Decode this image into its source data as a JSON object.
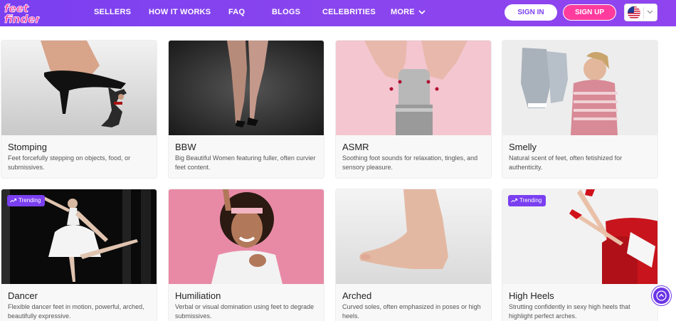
{
  "header": {
    "brand_color": "#7a3ff0",
    "nav": [
      {
        "label": "SELLERS"
      },
      {
        "label": "HOW IT WORKS"
      },
      {
        "label": "FAQ"
      },
      {
        "label": "BLOGS"
      },
      {
        "label": "CELEBRITIES"
      },
      {
        "label": "MORE"
      }
    ],
    "sign_in": "SIGN IN",
    "sign_up": "SIGN UP",
    "language_icon": "us-flag-icon",
    "accent_pink": "#ff3c9e"
  },
  "categories": [
    {
      "title": "Stomping",
      "description": "Feet forcefully stepping on objects, food, or submissives.",
      "trending": false
    },
    {
      "title": "BBW",
      "description": "Big Beautiful Women featuring fuller, often curvier feet content.",
      "trending": false
    },
    {
      "title": "ASMR",
      "description": "Soothing foot sounds for relaxation, tingles, and sensory pleasure.",
      "trending": false
    },
    {
      "title": "Smelly",
      "description": "Natural scent of feet, often fetishized for authenticity.",
      "trending": false
    },
    {
      "title": "Dancer",
      "description": "Flexible dancer feet in motion, powerful, arched, beautifully expressive.",
      "trending": true
    },
    {
      "title": "Humiliation",
      "description": "Verbal or visual domination using feet to degrade submissives.",
      "trending": false
    },
    {
      "title": "Arched",
      "description": "Curved soles, often emphasized in poses or high heels.",
      "trending": false
    },
    {
      "title": "High Heels",
      "description": "Strutting confidently in sexy high heels that highlight perfect arches.",
      "trending": true
    }
  ],
  "badge_label": "Trending"
}
